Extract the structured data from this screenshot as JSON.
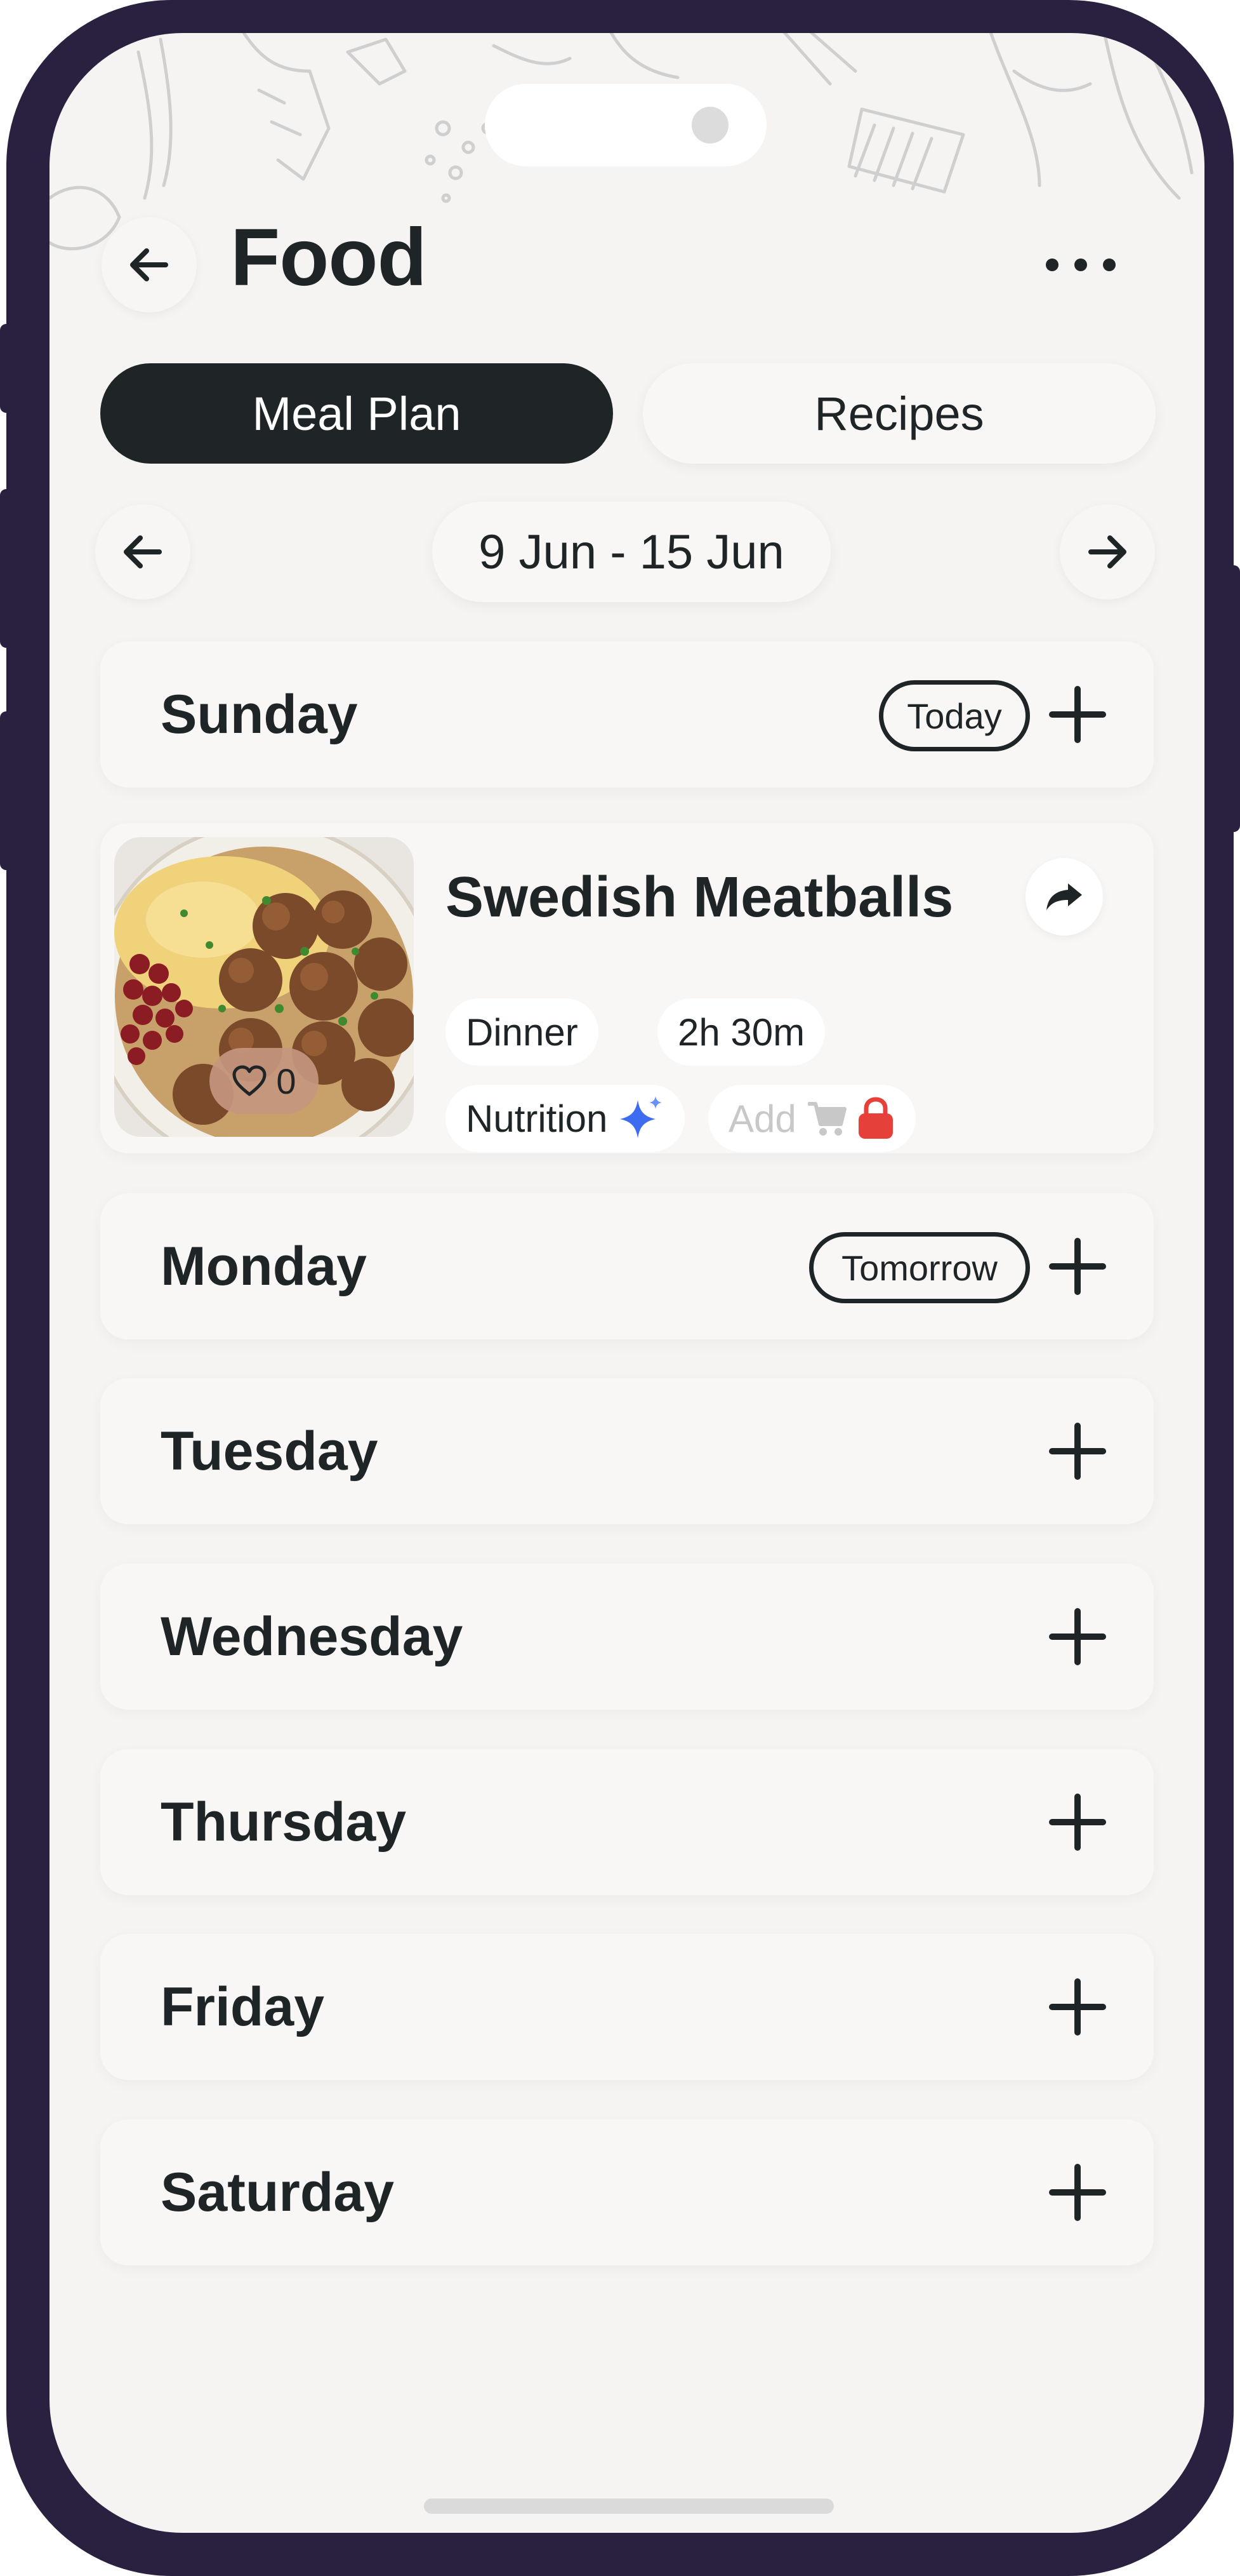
{
  "app": {
    "title": "Food"
  },
  "tabs": [
    {
      "label": "Meal Plan",
      "active": true
    },
    {
      "label": "Recipes",
      "active": false
    }
  ],
  "week": {
    "range": "9 Jun - 15 Jun"
  },
  "days": [
    {
      "name": "Sunday",
      "badge": "Today"
    },
    {
      "name": "Monday",
      "badge": "Tomorrow"
    },
    {
      "name": "Tuesday"
    },
    {
      "name": "Wednesday"
    },
    {
      "name": "Thursday"
    },
    {
      "name": "Friday"
    },
    {
      "name": "Saturday"
    }
  ],
  "meal": {
    "title": "Swedish Meatballs",
    "meal_type": "Dinner",
    "duration": "2h 30m",
    "nutrition_label": "Nutrition",
    "add_label": "Add",
    "likes": "0"
  },
  "colors": {
    "frame": "#2a2140",
    "screen_bg": "#f5f4f3",
    "primary_dark": "#1f2527",
    "lock_red": "#e5403a",
    "sparkle_blue": "#3d6cf0"
  },
  "icons": {
    "back": "arrow-left-icon",
    "more": "ellipsis-icon",
    "prev_week": "arrow-left-icon",
    "next_week": "arrow-right-icon",
    "add": "plus-icon",
    "share": "share-arrow-icon",
    "like": "heart-icon",
    "nutrition": "sparkle-icon",
    "cart": "cart-icon",
    "lock": "lock-icon"
  }
}
